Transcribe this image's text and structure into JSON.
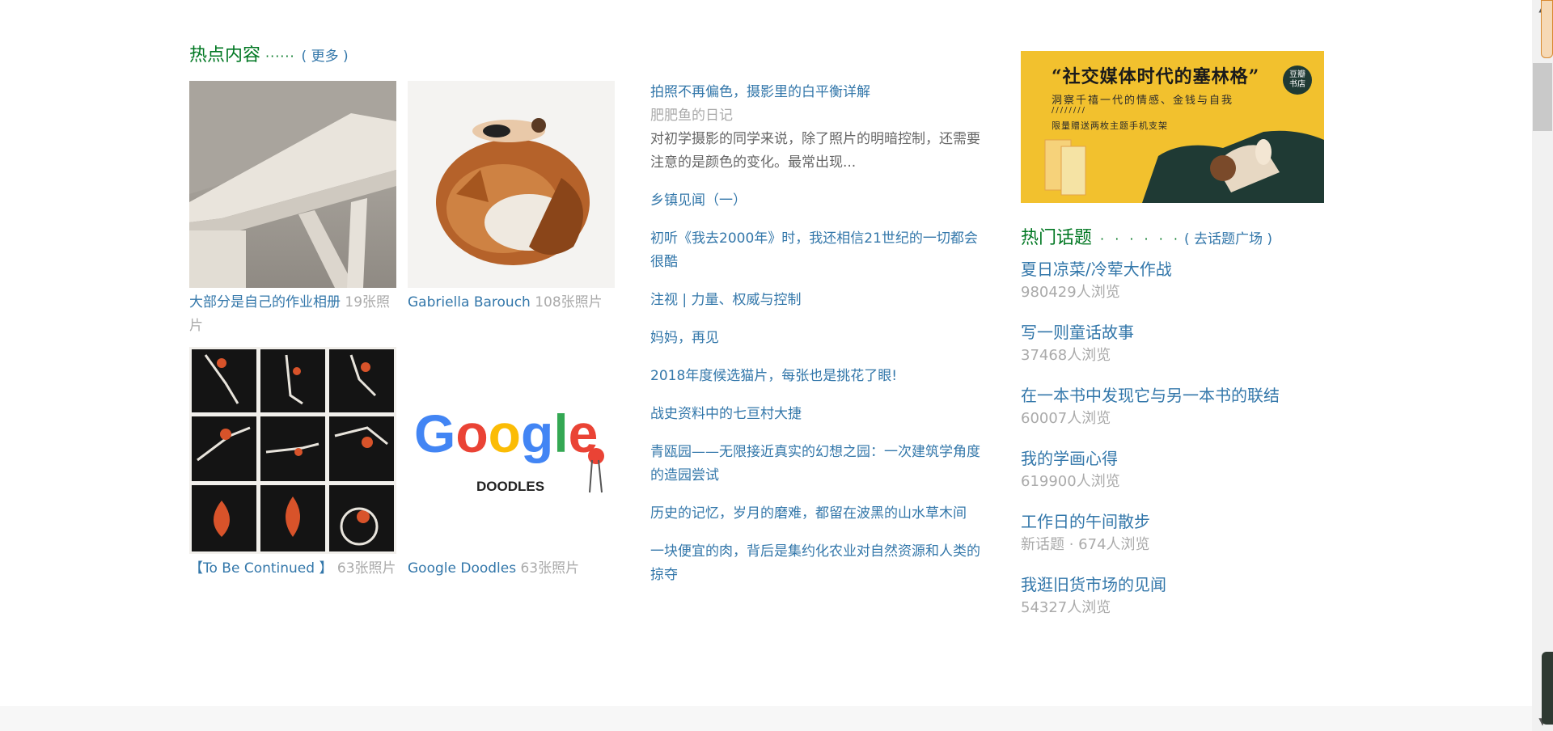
{
  "hot_content": {
    "title": "热点内容",
    "dots": "······",
    "more": "( 更多 )"
  },
  "albums": [
    {
      "title": "大部分是自己的作业相册",
      "count": "19张照片"
    },
    {
      "title": "Gabriella Barouch",
      "count": "108张照片"
    },
    {
      "title": "【To Be Continued 】",
      "count": "63张照片"
    },
    {
      "title": "Google Doodles",
      "count": "63张照片"
    }
  ],
  "google_doodle": {
    "word": "Google",
    "sub": "DOODLES"
  },
  "articles": [
    {
      "title": "拍照不再偏色，摄影里的白平衡详解",
      "author": "肥肥鱼的日记",
      "abstract": "对初学摄影的同学来说，除了照片的明暗控制，还需要注意的是颜色的变化。最常出现..."
    },
    {
      "title": "乡镇见闻（一）"
    },
    {
      "title": "初听《我去2000年》时，我还相信21世纪的一切都会很酷"
    },
    {
      "title": "注视 | 力量、权威与控制"
    },
    {
      "title": "妈妈，再见"
    },
    {
      "title": "2018年度候选猫片，每张也是挑花了眼!"
    },
    {
      "title": "战史资料中的七亘村大捷"
    },
    {
      "title": "青瓯园——无限接近真实的幻想之园：一次建筑学角度的造园尝试"
    },
    {
      "title": "历史的记忆，岁月的磨难，都留在波黑的山水草木间"
    },
    {
      "title": "一块便宜的肉，背后是集约化农业对自然资源和人类的掠夺"
    }
  ],
  "ad": {
    "headline": "“社交媒体时代的塞林格”",
    "subline": "洞察千禧一代的情感、金钱与自我",
    "marks": "////////",
    "promo": "限量赠送两枚主题手机支架",
    "badge_line1": "豆瓣",
    "badge_line2": "书店",
    "colors": {
      "background": "#f2c12e",
      "sofa": "#1f3a34"
    }
  },
  "hot_topics": {
    "title": "热门话题",
    "dots": "· · · · · ·",
    "more": "( 去话题广场 )",
    "items": [
      {
        "title": "夏日凉菜/冷荤大作战",
        "views": "980429人浏览"
      },
      {
        "title": "写一则童话故事",
        "views": "37468人浏览"
      },
      {
        "title": "在一本书中发现它与另一本书的联结",
        "views": "60007人浏览"
      },
      {
        "title": "我的学画心得",
        "views": "619900人浏览"
      },
      {
        "title": "工作日的午间散步",
        "views": "新话题 · 674人浏览"
      },
      {
        "title": "我逛旧货市场的见闻",
        "views": "54327人浏览"
      }
    ]
  },
  "colors": {
    "link": "#3377aa",
    "heading": "#007722",
    "muted": "#aaaaaa"
  }
}
